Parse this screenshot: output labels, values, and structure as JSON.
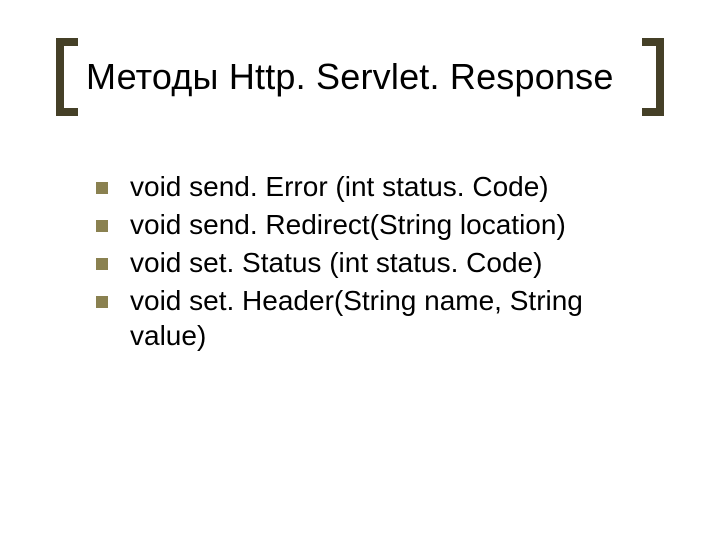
{
  "title": "Методы Http. Servlet. Response",
  "items": [
    "void send. Error (int status. Code)",
    "void send. Redirect(String location)",
    "void set. Status (int status. Code)",
    "void set. Header(String name, String value)"
  ]
}
